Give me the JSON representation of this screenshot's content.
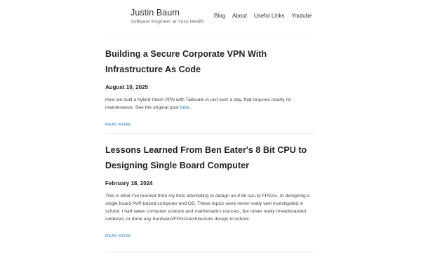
{
  "header": {
    "site_title": "Justin Baum",
    "tagline": "Software Engineer at Yuzu Health",
    "nav": [
      {
        "label": "Blog"
      },
      {
        "label": "About"
      },
      {
        "label": "Useful Links"
      },
      {
        "label": "Youtube"
      }
    ]
  },
  "posts": [
    {
      "title_line1": "Building a Secure Corporate VPN With",
      "title_line2": "Infrastructure As Code",
      "date": "August 10, 2025",
      "excerpt": "How we built a hybrid mesh VPN with Tailscale in just over a day, that requires nearly no maintenance. See the original post ",
      "excerpt_link": "here",
      "excerpt_end": ".",
      "read_more": "READ MORE"
    },
    {
      "title_line1": "Lessons Learned From Ben Eater's 8 Bit CPU to",
      "title_line2": "Designing Single Board Computer",
      "date": "February 18, 2024",
      "excerpt": "This is what I've learned from my time attempting to design an 8 bit cpu to FPGAs, to designing a single board AVR based computer and OS. These topics were never really well investigated in school. I had taken computer science and mathematics courses, but never really breadboarded, soldered, or done any hardware/FPGA/architecture design in school.",
      "read_more": "READ MORE"
    }
  ]
}
